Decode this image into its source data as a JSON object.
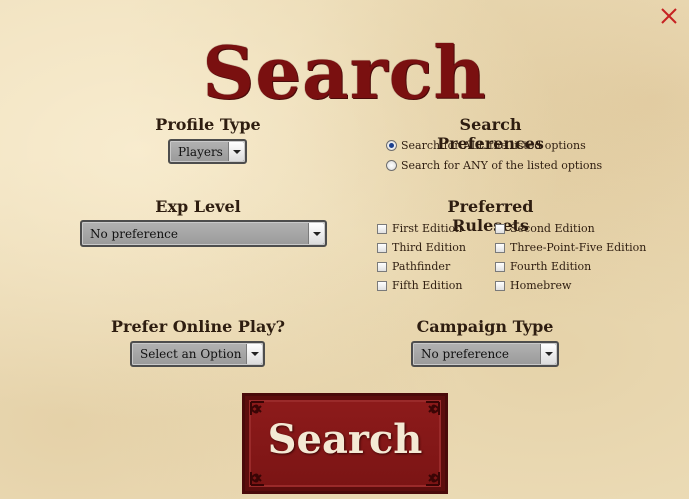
{
  "title": "Search",
  "close_icon": "close-icon",
  "accent_color": "#7a1010",
  "profile_type": {
    "label": "Profile Type",
    "selected": "Players"
  },
  "search_preferences": {
    "label": "Search Preferences",
    "options": [
      {
        "label": "Search for ALL the listed options",
        "checked": true
      },
      {
        "label": "Search for ANY of the listed options",
        "checked": false
      }
    ]
  },
  "exp_level": {
    "label": "Exp Level",
    "selected": "No preference"
  },
  "preferred_rulesets": {
    "label": "Preferred Rulesets",
    "options": [
      "First Edition",
      "Second Edition",
      "Third Edition",
      "Three-Point-Five Edition",
      "Pathfinder",
      "Fourth Edition",
      "Fifth Edition",
      "Homebrew"
    ]
  },
  "online_play": {
    "label": "Prefer Online Play?",
    "selected": "Select an Option"
  },
  "campaign_type": {
    "label": "Campaign Type",
    "selected": "No preference"
  },
  "search_button": {
    "label": "Search"
  }
}
